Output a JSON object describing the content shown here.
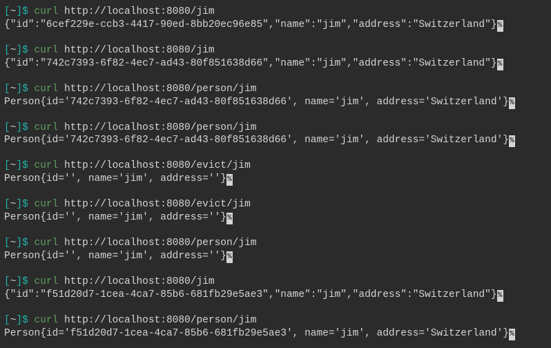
{
  "prompt": {
    "open_bracket": "[",
    "tilde": "~",
    "close_bracket": "]",
    "dollar": "$"
  },
  "curl": "curl",
  "blocks": [
    {
      "url": "http://localhost:8080/jim",
      "output": "{\"id\":\"6cef229e-ccb3-4417-90ed-8bb20ec96e85\",\"name\":\"jim\",\"address\":\"Switzerland\"}"
    },
    {
      "url": "http://localhost:8080/jim",
      "output": "{\"id\":\"742c7393-6f82-4ec7-ad43-80f851638d66\",\"name\":\"jim\",\"address\":\"Switzerland\"}"
    },
    {
      "url": "http://localhost:8080/person/jim",
      "output": "Person{id='742c7393-6f82-4ec7-ad43-80f851638d66', name='jim', address='Switzerland'}"
    },
    {
      "url": "http://localhost:8080/person/jim",
      "output": "Person{id='742c7393-6f82-4ec7-ad43-80f851638d66', name='jim', address='Switzerland'}"
    },
    {
      "url": "http://localhost:8080/evict/jim",
      "output": "Person{id='', name='jim', address=''}"
    },
    {
      "url": "http://localhost:8080/evict/jim",
      "output": "Person{id='', name='jim', address=''}"
    },
    {
      "url": "http://localhost:8080/person/jim",
      "output": "Person{id='', name='jim', address=''}"
    },
    {
      "url": "http://localhost:8080/jim",
      "output": "{\"id\":\"f51d20d7-1cea-4ca7-85b6-681fb29e5ae3\",\"name\":\"jim\",\"address\":\"Switzerland\"}"
    },
    {
      "url": "http://localhost:8080/person/jim",
      "output": "Person{id='f51d20d7-1cea-4ca7-85b6-681fb29e5ae3', name='jim', address='Switzerland'}"
    }
  ],
  "eol_marker": "%"
}
